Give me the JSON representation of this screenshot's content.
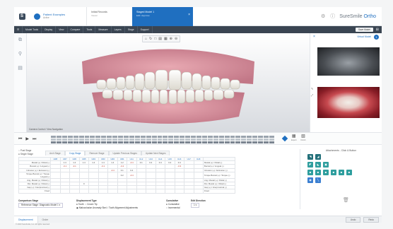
{
  "header": {
    "patient_name": "Patient Examples",
    "patient_sub": "Active",
    "tab1_title": "Initial Records",
    "tab1_sub": "Viewer",
    "tab2_title": "Staged Model 1",
    "tab2_sub": "Edit / Approve",
    "brand_prefix": "SureSmile",
    "brand_suffix": " Ortho",
    "settings_icon": "gear-icon",
    "help_icon": "help-icon"
  },
  "toolbar": {
    "items": [
      "Model Tools",
      "Display",
      "View",
      "Compare",
      "Tools",
      "Measure",
      "Layers",
      "Stage",
      "Support"
    ],
    "save_label": "Save Model"
  },
  "viewer": {
    "caption": "Camera Control / View Navigation",
    "tools": [
      "⌂",
      "↻",
      "□",
      "▤",
      "▦",
      "⊕",
      "⊖"
    ]
  },
  "rpanel": {
    "link": "Virtual Model",
    "bubble": "1"
  },
  "timeline": {
    "tool1": "Export",
    "tool2": "Finish"
  },
  "stage": {
    "radio1": "Post Stage",
    "radio2": "Single Stage",
    "tabs": [
      "Arch Stage",
      "Copy Stage",
      "Remove Stage",
      "Update Previous Stages",
      "Update Next Stages"
    ],
    "columns": [
      "UR8",
      "UR7",
      "UR6",
      "UR5",
      "UR4",
      "UR3",
      "UR2",
      "UR1",
      "UL1",
      "UL2",
      "UL3",
      "UL4",
      "UL5",
      "UL6",
      "UL7",
      "UL8"
    ],
    "rows": [
      {
        "label": "Mesial (+) / Distal (-)",
        "values": [
          "",
          "1.4",
          "1.4",
          "1.4",
          "1.4",
          "1.4",
          "1.4",
          "1.2",
          "-0.4",
          "0.1",
          "0.4",
          "0.4",
          "0.4",
          "0.4",
          "",
          ""
        ],
        "rlabel": "Mesial (+) / Distal (-)"
      },
      {
        "label": "Buccal (+) / Lingual (-)",
        "values": [
          "",
          "-0.1",
          "-0.1",
          "",
          "",
          "-0.1",
          "",
          "-0.2",
          "",
          "",
          "",
          "",
          "",
          "-0.3",
          "",
          ""
        ],
        "rlabel": "Buccal (+) / Lingual (-)"
      },
      {
        "label": "Intrusion (+) / Extrusion (-)",
        "values": [
          "",
          "",
          "",
          "",
          "",
          "",
          "-0.4",
          "0.1",
          "0.4",
          "",
          "",
          "",
          "",
          "",
          "",
          ""
        ],
        "rlabel": "Intrusion (+) / Extrusion (-)"
      },
      {
        "label": "Torque Buccal (+) / Torque Lingual (-)",
        "values": [
          "",
          "",
          "",
          "",
          "",
          "",
          "",
          "0.2",
          "-0.4",
          "",
          "",
          "",
          "",
          "",
          "",
          ""
        ],
        "rlabel": "Torque Buccal (+) / Torque (-)"
      },
      {
        "label": "Ang. Mesial (+) / Distal (-)",
        "values": [
          "",
          "",
          "",
          "",
          "",
          "",
          "",
          "",
          "",
          "",
          "",
          "",
          "",
          "",
          "",
          ""
        ],
        "rlabel": "Ang. Mesial (+) / Distal (-)"
      },
      {
        "label": "Rot. Mesial (+) / Distal (-)",
        "values": [
          "",
          "",
          "",
          "0",
          "",
          "",
          "",
          "",
          "",
          "",
          "",
          "",
          "",
          "",
          "",
          ""
        ],
        "rlabel": "Rot. Mesial (+) / Distal (-)"
      },
      {
        "label": "Gap (+) / Interproximal (-)",
        "values": [
          "",
          "",
          "",
          "",
          "",
          "",
          "",
          "",
          "",
          "",
          "",
          "",
          "",
          "",
          "",
          ""
        ],
        "rlabel": "Gap (+) / Interproximal (-)"
      },
      {
        "label": "Fixed",
        "values": [
          "",
          "",
          "",
          "",
          "",
          "",
          "",
          "",
          "",
          "",
          "",
          "",
          "",
          "",
          "",
          ""
        ],
        "rlabel": "Fixed"
      }
    ]
  },
  "comparison": {
    "label": "Comparison Stage",
    "value": "Reference Stage: Diagnostic Model 1 ▾"
  },
  "movement": {
    "label": "Displacement Type",
    "opt1": "Tooth",
    "opt2": "Crown Tip",
    "opt3": "Malocclusion Anomaly Skel.",
    "opt4": "Tooth Alignment Adjustments"
  },
  "cumulative": {
    "label": "Cumulative",
    "opt1": "Cumulative",
    "opt2": "Incremental"
  },
  "edit": {
    "label": "Edit Direction",
    "value": "1 ▾"
  },
  "attachments": {
    "title": "Attachments - Click & Button",
    "cells": [
      "◥",
      "◢",
      "",
      "",
      "",
      "",
      "◤",
      "◣",
      "▣",
      "",
      "",
      "",
      "■",
      "■",
      "■",
      "■",
      "■",
      "■",
      "◉",
      "╲",
      "",
      "",
      "",
      ""
    ]
  },
  "footer": {
    "tab1": "Displacement",
    "tab2": "Order",
    "btn1": "Undo",
    "btn2": "Redo",
    "copyright": "© 2023 SureSmile, Inc. All rights reserved."
  },
  "colors": {
    "accent": "#1f6fc0",
    "toolbar": "#3a4552",
    "attachment": "#2e9e9e"
  }
}
